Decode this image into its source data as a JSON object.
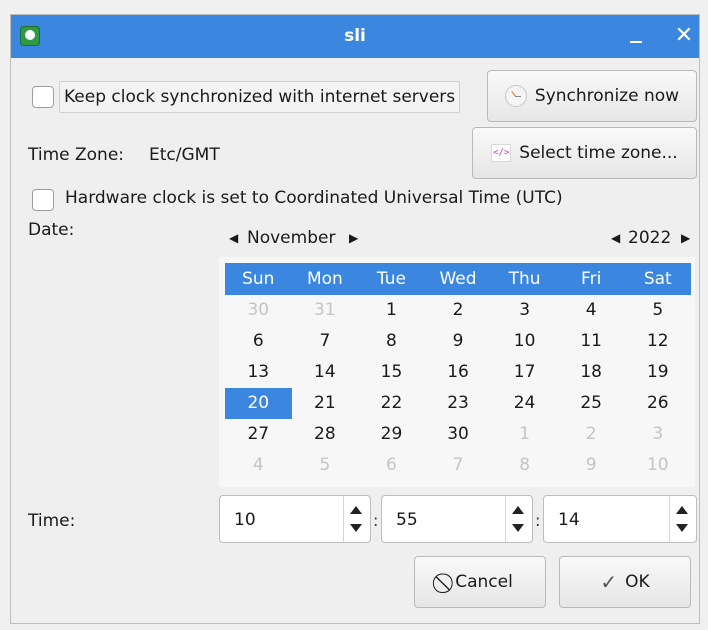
{
  "window": {
    "title": "sli"
  },
  "sync": {
    "label": "Keep clock synchronized with internet servers",
    "button": "Synchronize now"
  },
  "timezone": {
    "label": "Time Zone:",
    "value": "Etc/GMT",
    "button": "Select time zone..."
  },
  "hwclock": {
    "label": "Hardware clock is set to Coordinated Universal Time (UTC)"
  },
  "date": {
    "label": "Date:",
    "month": "November",
    "year": "2022",
    "day_headers": [
      "Sun",
      "Mon",
      "Tue",
      "Wed",
      "Thu",
      "Fri",
      "Sat"
    ],
    "weeks": [
      [
        "30",
        "31",
        "1",
        "2",
        "3",
        "4",
        "5"
      ],
      [
        "6",
        "7",
        "8",
        "9",
        "10",
        "11",
        "12"
      ],
      [
        "13",
        "14",
        "15",
        "16",
        "17",
        "18",
        "19"
      ],
      [
        "20",
        "21",
        "22",
        "23",
        "24",
        "25",
        "26"
      ],
      [
        "27",
        "28",
        "29",
        "30",
        "1",
        "2",
        "3"
      ],
      [
        "4",
        "5",
        "6",
        "7",
        "8",
        "9",
        "10"
      ]
    ],
    "selected_day": "20"
  },
  "time": {
    "label": "Time:",
    "hour": "10",
    "minute": "55",
    "second": "14",
    "separator": ":"
  },
  "buttons": {
    "cancel": "Cancel",
    "ok": "OK"
  }
}
